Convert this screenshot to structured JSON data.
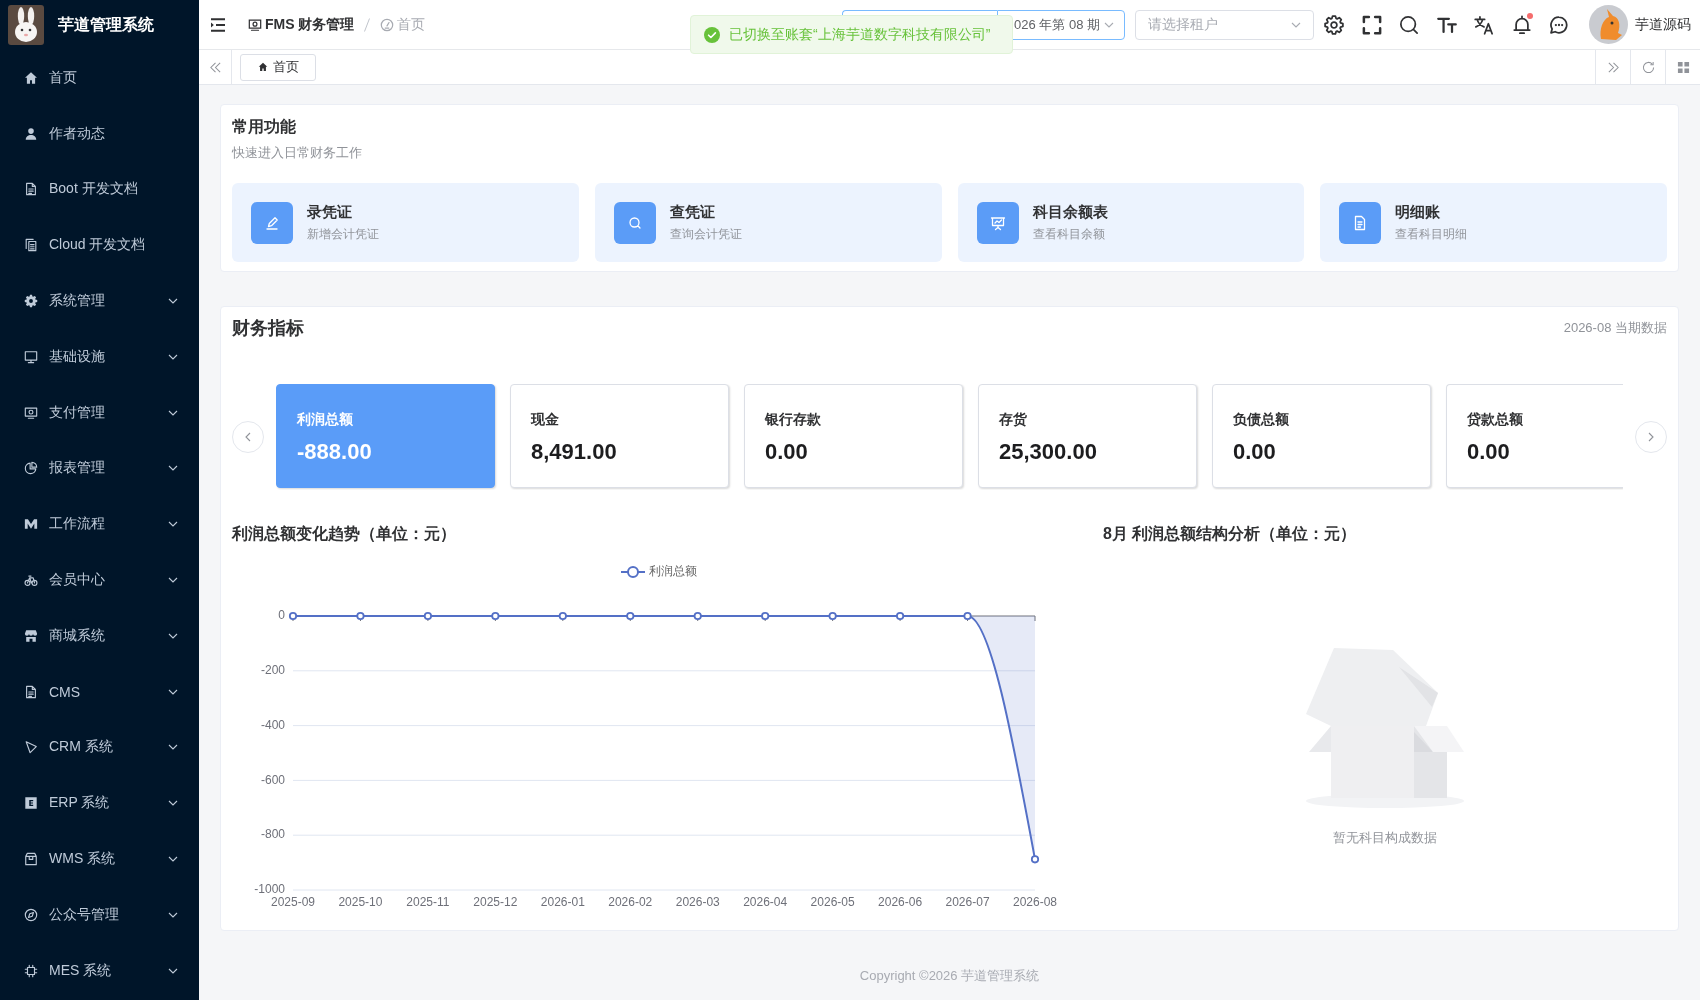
{
  "sidebar": {
    "title": "芋道管理系统",
    "items": [
      {
        "label": "首页",
        "kind": "page"
      },
      {
        "label": "作者动态",
        "kind": "page"
      },
      {
        "label": "Boot 开发文档",
        "kind": "page"
      },
      {
        "label": "Cloud 开发文档",
        "kind": "page"
      },
      {
        "label": "系统管理",
        "kind": "group"
      },
      {
        "label": "基础设施",
        "kind": "group"
      },
      {
        "label": "支付管理",
        "kind": "group"
      },
      {
        "label": "报表管理",
        "kind": "group"
      },
      {
        "label": "工作流程",
        "kind": "group"
      },
      {
        "label": "会员中心",
        "kind": "group"
      },
      {
        "label": "商城系统",
        "kind": "group"
      },
      {
        "label": "CMS",
        "kind": "group"
      },
      {
        "label": "CRM 系统",
        "kind": "group"
      },
      {
        "label": "ERP 系统",
        "kind": "group"
      },
      {
        "label": "WMS 系统",
        "kind": "group"
      },
      {
        "label": "公众号管理",
        "kind": "group"
      },
      {
        "label": "MES 系统",
        "kind": "group"
      }
    ]
  },
  "header": {
    "breadcrumb": [
      {
        "label": "FMS 财务管理",
        "current": false
      },
      {
        "label": "首页",
        "current": true
      }
    ],
    "period_select": {
      "value": "026 年第 08 期"
    },
    "tenant_select": {
      "placeholder": "请选择租户"
    },
    "notifications": {
      "unread": true
    },
    "user": {
      "name": "芋道源码"
    }
  },
  "toast": {
    "kind": "success",
    "message": "已切换至账套“上海芋道数字科技有限公司”"
  },
  "tabs": [
    {
      "label": "首页",
      "selected": true
    }
  ],
  "quick_functions": {
    "title": "常用功能",
    "subtitle": "快速进入日常财务工作",
    "items": [
      {
        "title": "录凭证",
        "desc": "新增会计凭证"
      },
      {
        "title": "查凭证",
        "desc": "查询会计凭证"
      },
      {
        "title": "科目余额表",
        "desc": "查看科目余额"
      },
      {
        "title": "明细账",
        "desc": "查看科目明细"
      }
    ]
  },
  "financial_metrics": {
    "title": "财务指标",
    "period_note": "2026-08 当期数据",
    "items": [
      {
        "label": "利润总额",
        "value": "-888.00",
        "selected": true
      },
      {
        "label": "现金",
        "value": "8,491.00",
        "selected": false
      },
      {
        "label": "银行存款",
        "value": "0.00",
        "selected": false
      },
      {
        "label": "存货",
        "value": "25,300.00",
        "selected": false
      },
      {
        "label": "负债总额",
        "value": "0.00",
        "selected": false
      },
      {
        "label": "贷款总额",
        "value": "0.00",
        "selected": false
      }
    ],
    "trend_chart": {
      "title": "利润总额变化趋势（单位：元）",
      "chart_data": {
        "type": "area",
        "categories": [
          "2025-09",
          "2025-10",
          "2025-11",
          "2025-12",
          "2026-01",
          "2026-02",
          "2026-03",
          "2026-04",
          "2026-05",
          "2026-06",
          "2026-07",
          "2026-08"
        ],
        "series": [
          {
            "name": "利润总额",
            "color": "#5470c6",
            "values": [
              0,
              0,
              0,
              0,
              0,
              0,
              0,
              0,
              0,
              0,
              0,
              -888
            ]
          }
        ],
        "ylim": [
          -1000,
          0
        ],
        "yticks": [
          0,
          -200,
          -400,
          -600,
          -800,
          -1000
        ],
        "grid": true
      }
    },
    "structure_chart": {
      "title": "8月 利润总额结构分析（单位：元）",
      "empty_text": "暂无科目构成数据"
    }
  },
  "footer": {
    "copyright": "Copyright ©2026 芋道管理系统"
  }
}
